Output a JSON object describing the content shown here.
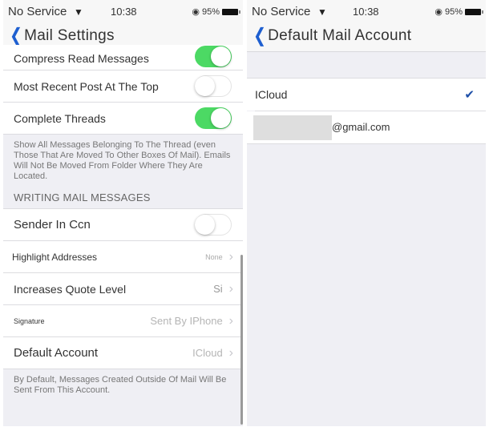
{
  "left_screen": {
    "status_bar": {
      "carrier": "No Service",
      "wifi_icon": "wifi-icon",
      "time": "10:38",
      "lock_icon": "rotation-lock-icon",
      "battery": "95%",
      "battery_icon": "battery-icon"
    },
    "nav": {
      "back_icon": "chevron-left-icon",
      "title": "Mail Settings"
    },
    "threading_rows": [
      {
        "label": "Compress Read Messages",
        "control": "toggle",
        "on": true
      },
      {
        "label": "Most Recent Post At The Top",
        "control": "toggle",
        "on": false
      },
      {
        "label": "Complete Threads",
        "control": "toggle",
        "on": true
      }
    ],
    "threading_footer": "Show All Messages Belonging To The Thread (even Those That Are Moved To Other Boxes Of Mail). Emails Will Not Be Moved From Folder Where They Are Located.",
    "writing_section": {
      "header": "WRITING MAIL MESSAGES",
      "rows": [
        {
          "label": "Sender In Ccn",
          "control": "toggle",
          "on": false
        },
        {
          "label": "Highlight Addresses",
          "value": "None",
          "control": "disclosure"
        },
        {
          "label": "Increases Quote Level",
          "value": "Si",
          "control": "disclosure"
        },
        {
          "label": "Signature",
          "value": "Sent By IPhone",
          "control": "disclosure"
        },
        {
          "label": "Default Account",
          "value": "ICloud",
          "control": "disclosure"
        }
      ],
      "footer": "By Default, Messages Created Outside Of Mail Will Be Sent From This Account."
    },
    "colors": {
      "toggle_on": "#4cd964",
      "tint": "#1e5fd0",
      "background": "#efeff4"
    }
  },
  "right_screen": {
    "status_bar": {
      "carrier": "No Service",
      "wifi_icon": "wifi-icon",
      "time": "10:38",
      "lock_icon": "rotation-lock-icon",
      "battery": "95%",
      "battery_icon": "battery-icon"
    },
    "nav": {
      "back_icon": "chevron-left-icon",
      "title": "Default Mail Account"
    },
    "accounts": [
      {
        "label": "ICloud",
        "selected": true,
        "check_icon": "checkmark-icon"
      },
      {
        "label": "@gmail.com",
        "selected": false,
        "redacted_prefix": true
      }
    ]
  }
}
